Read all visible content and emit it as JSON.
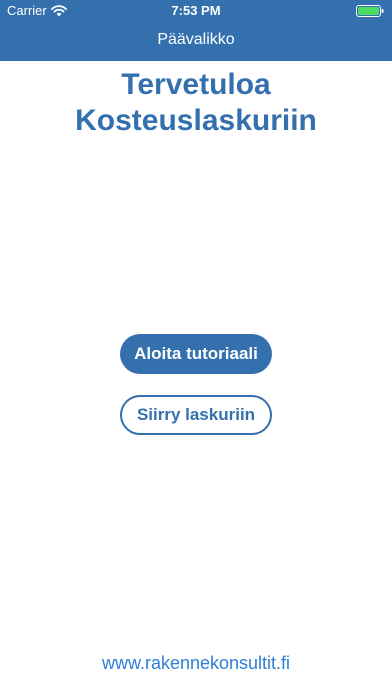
{
  "status_bar": {
    "carrier": "Carrier",
    "time": "7:53 PM",
    "wifi_icon": "wifi-icon",
    "battery_icon": "battery-icon",
    "battery_color": "#4cd964"
  },
  "nav": {
    "title": "Päävalikko"
  },
  "main": {
    "welcome_line1": "Tervetuloa",
    "welcome_line2": "Kosteuslaskuriin",
    "start_tutorial_label": "Aloita tutoriaali",
    "go_to_calculator_label": "Siirry laskuriin"
  },
  "footer": {
    "link_text": "www.rakennekonsultit.fi"
  },
  "colors": {
    "brand_blue": "#3370ad",
    "link_blue": "#2e7fd9",
    "background": "#ffffff"
  }
}
